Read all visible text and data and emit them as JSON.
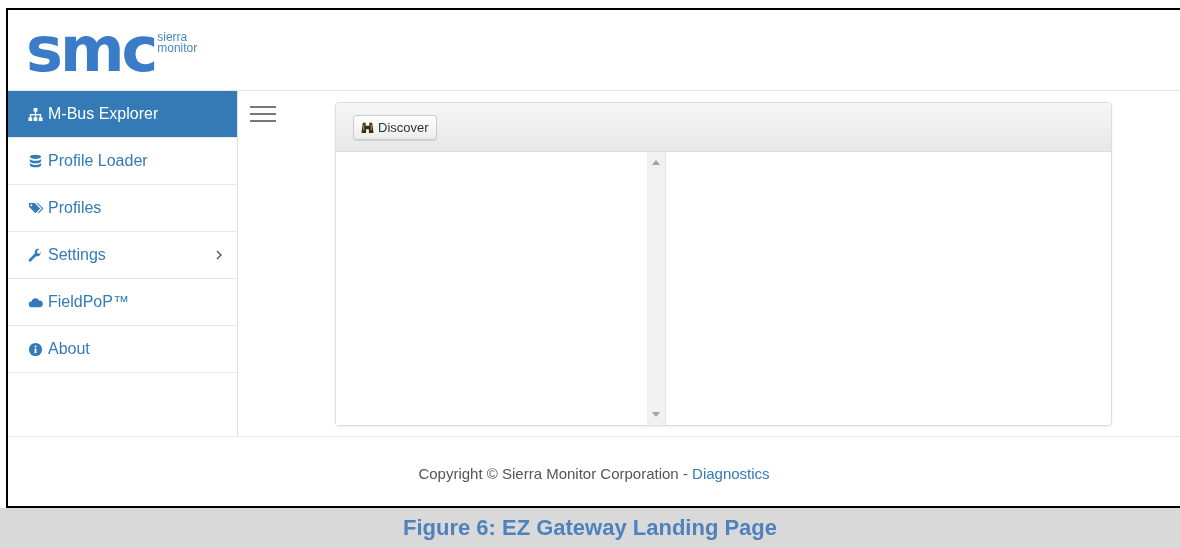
{
  "logo": {
    "mark": "smc",
    "tagline": [
      "sierra",
      "monitor"
    ]
  },
  "sidebar": {
    "items": [
      {
        "label": "M-Bus Explorer",
        "selected": true,
        "has_submenu": false
      },
      {
        "label": "Profile Loader",
        "selected": false,
        "has_submenu": false
      },
      {
        "label": "Profiles",
        "selected": false,
        "has_submenu": false
      },
      {
        "label": "Settings",
        "selected": false,
        "has_submenu": true
      },
      {
        "label": "FieldPoP™",
        "selected": false,
        "has_submenu": false
      },
      {
        "label": "About",
        "selected": false,
        "has_submenu": false
      }
    ]
  },
  "panel": {
    "toolbar_button": "Discover"
  },
  "footer": {
    "text": "Copyright © Sierra Monitor Corporation - ",
    "link": "Diagnostics"
  },
  "caption": "Figure 6: EZ Gateway Landing Page"
}
